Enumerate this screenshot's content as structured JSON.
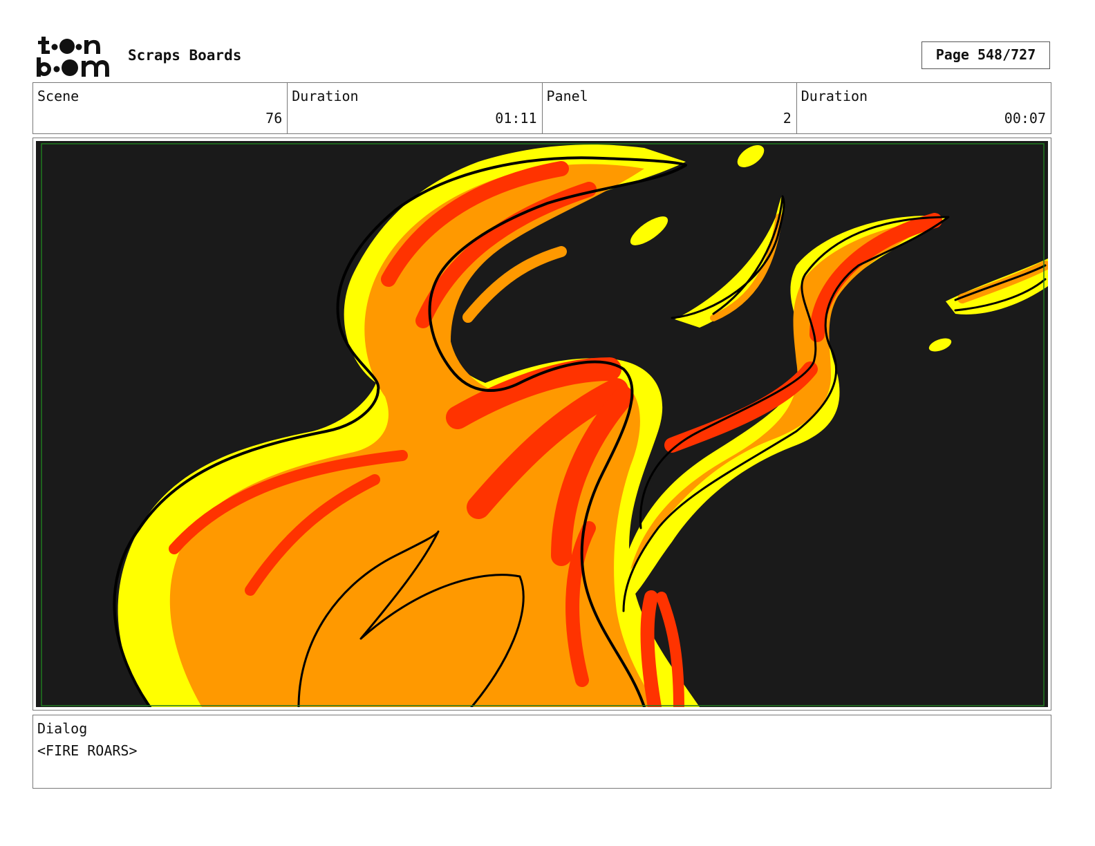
{
  "header": {
    "logo_name": "toon-boom-logo",
    "project_title": "Scraps Boards",
    "page_counter": "Page 548/727"
  },
  "info": {
    "scene_label": "Scene",
    "scene_value": "76",
    "scene_duration_label": "Duration",
    "scene_duration_value": "01:11",
    "panel_label": "Panel",
    "panel_value": "2",
    "panel_duration_label": "Duration",
    "panel_duration_value": "00:07"
  },
  "panel": {
    "background_color": "#1a1a1a",
    "safe_area_color": "#1f7a1f",
    "flame_colors": {
      "yellow": "#ffff00",
      "orange": "#ff9900",
      "red": "#ff3300",
      "outline": "#000000"
    }
  },
  "dialog": {
    "label": "Dialog",
    "text": "<FIRE ROARS>"
  }
}
